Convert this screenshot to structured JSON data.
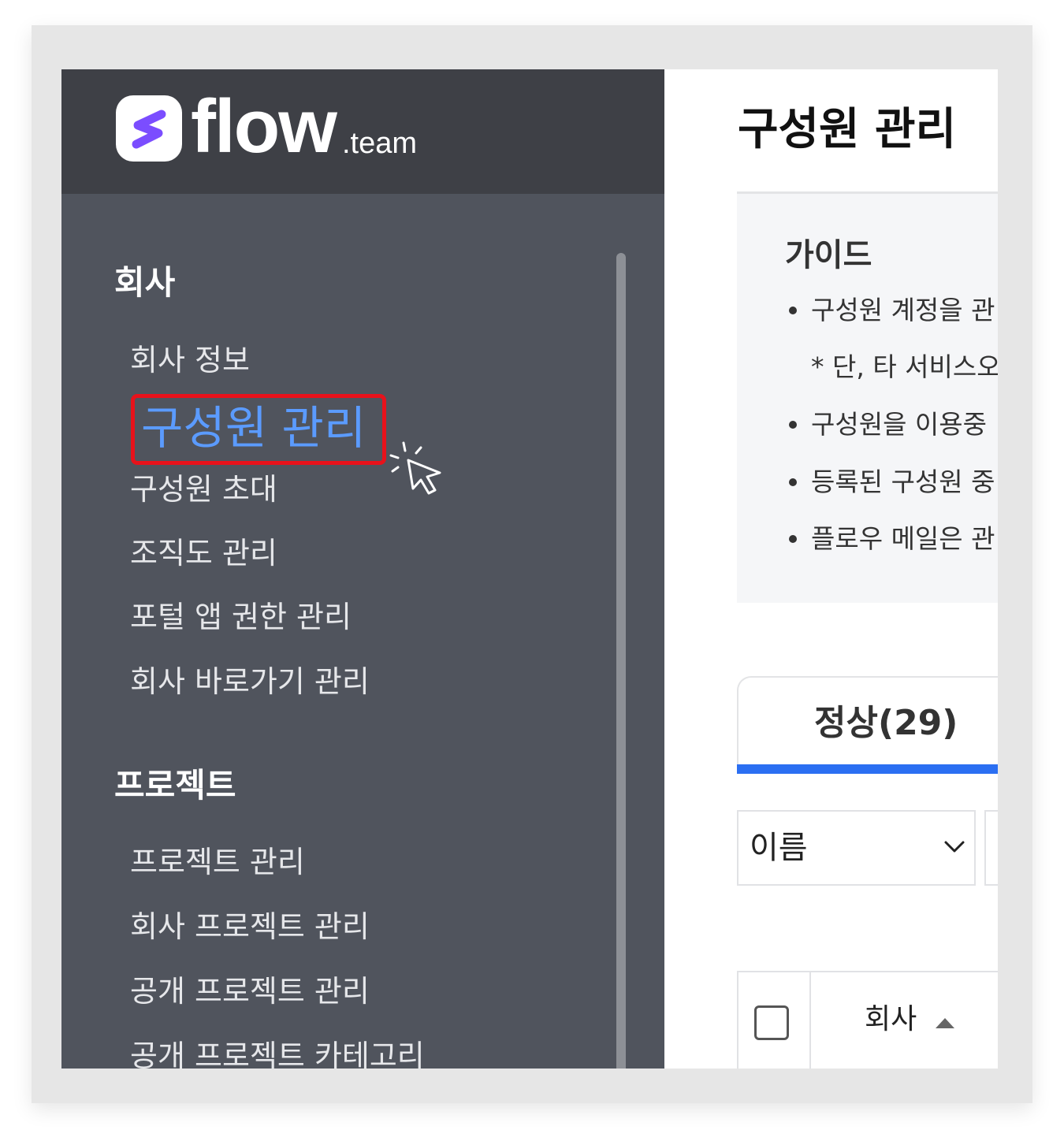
{
  "brand": {
    "name": "flow",
    "suffix": ".team",
    "color": "#7b4dff"
  },
  "sidebar": {
    "sections": [
      {
        "title": "회사",
        "items": [
          {
            "label": "회사 정보"
          },
          {
            "label": "구성원 관리",
            "active": true
          },
          {
            "label": "구성원 초대"
          },
          {
            "label": "조직도 관리"
          },
          {
            "label": "포털 앱 권한 관리"
          },
          {
            "label": "회사 바로가기 관리"
          }
        ]
      },
      {
        "title": "프로젝트",
        "items": [
          {
            "label": "프로젝트 관리"
          },
          {
            "label": "회사 프로젝트 관리"
          },
          {
            "label": "공개 프로젝트 관리"
          },
          {
            "label": "공개 프로젝트 카테고리"
          }
        ]
      }
    ],
    "highlight_color": "#e8121b",
    "active_color": "#5b9bff"
  },
  "main": {
    "title": "구성원 관리",
    "guide": {
      "title": "가이드",
      "lines": [
        "구성원 계정을 관",
        "* 단, 타 서비스오",
        "구성원을 이용중",
        "등록된 구성원 중",
        "플로우 메일은 관"
      ]
    },
    "tab": {
      "label": "정상(29)",
      "accent": "#2b6ff2"
    },
    "filter": {
      "selected": "이름"
    },
    "table": {
      "column": "회사"
    }
  }
}
